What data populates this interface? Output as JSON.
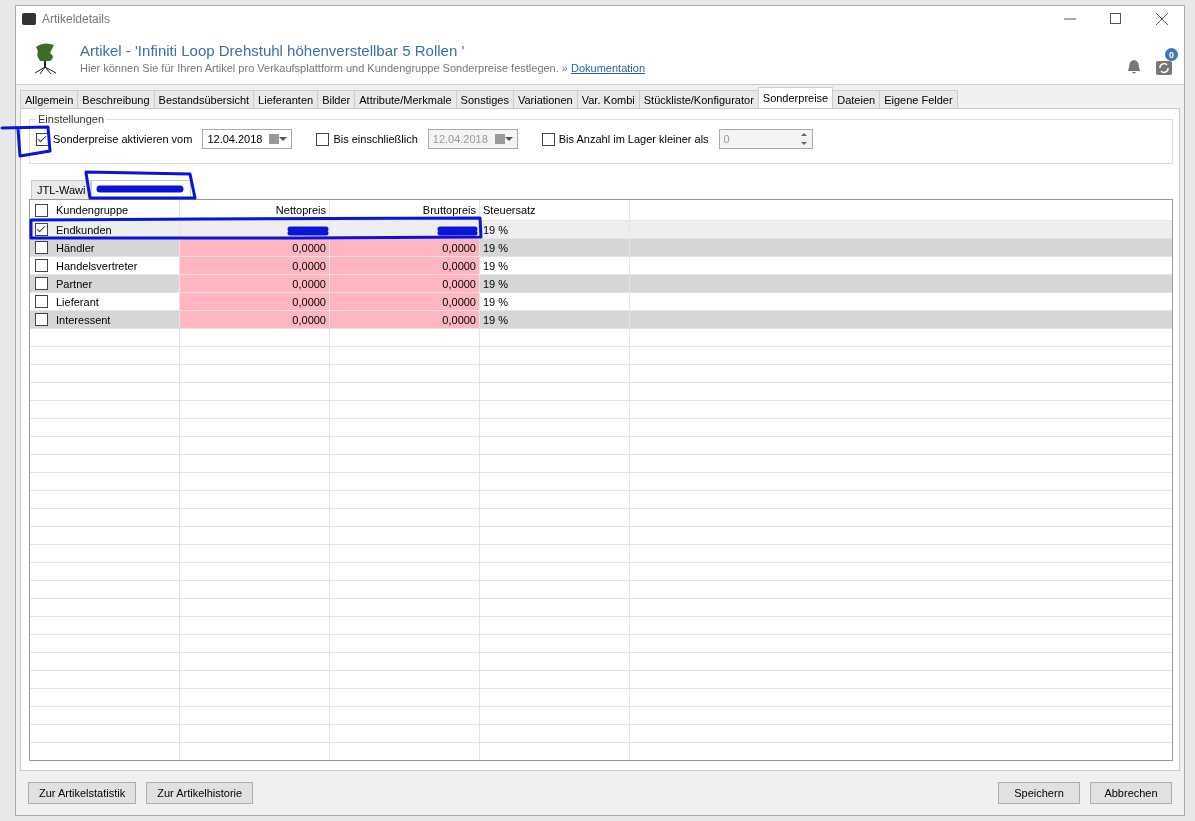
{
  "window": {
    "title": "Artikeldetails"
  },
  "header": {
    "title": "Artikel - 'Infiniti Loop Drehstuhl höhenverstellbar 5 Rollen '",
    "subtitle": "Hier können Sie für Ihren Artikel pro Verkaufsplattform und Kundengruppe Sonderpreise festlegen. »",
    "link": "Dokumentation",
    "badge": "0"
  },
  "tabs": [
    {
      "label": "Allgemein",
      "selected": false
    },
    {
      "label": "Beschreibung",
      "selected": false
    },
    {
      "label": "Bestandsübersicht",
      "selected": false
    },
    {
      "label": "Lieferanten",
      "selected": false
    },
    {
      "label": "Bilder",
      "selected": false
    },
    {
      "label": "Attribute/Merkmale",
      "selected": false
    },
    {
      "label": "Sonstiges",
      "selected": false
    },
    {
      "label": "Variationen",
      "selected": false
    },
    {
      "label": "Var. Kombi",
      "selected": false
    },
    {
      "label": "Stückliste/Konfigurator",
      "selected": false
    },
    {
      "label": "Sonderpreise",
      "selected": true
    },
    {
      "label": "Dateien",
      "selected": false
    },
    {
      "label": "Eigene Felder",
      "selected": false
    }
  ],
  "settings": {
    "title": "Einstellungen",
    "active_from": {
      "label": "Sonderpreise aktivieren vom",
      "checked": true,
      "date": "12.04.2018"
    },
    "until": {
      "label": "Bis einschließlich",
      "checked": false,
      "date": "12.04.2018"
    },
    "stock": {
      "label": "Bis Anzahl im Lager kleiner als",
      "checked": false,
      "value": "0"
    }
  },
  "platform_tabs": [
    {
      "label": "JTL-Wawi",
      "selected": false
    },
    {
      "selected": true
    }
  ],
  "table": {
    "all_selected": false,
    "columns": [
      "Kundengruppe",
      "Nettopreis",
      "Bruttopreis",
      "Steuersatz"
    ],
    "rows": [
      {
        "name": "Endkunden",
        "checked": true,
        "tax": "19 %"
      },
      {
        "name": "Händler",
        "checked": false,
        "net": "0,0000",
        "gross": "0,0000",
        "tax": "19 %"
      },
      {
        "name": "Handelsvertreter",
        "checked": false,
        "net": "0,0000",
        "gross": "0,0000",
        "tax": "19 %"
      },
      {
        "name": "Partner",
        "checked": false,
        "net": "0,0000",
        "gross": "0,0000",
        "tax": "19 %"
      },
      {
        "name": "Lieferant",
        "checked": false,
        "net": "0,0000",
        "gross": "0,0000",
        "tax": "19 %"
      },
      {
        "name": "Interessent",
        "checked": false,
        "net": "0,0000",
        "gross": "0,0000",
        "tax": "19 %"
      }
    ]
  },
  "footer": {
    "left_buttons": [
      "Zur Artikelstatistik",
      "Zur Artikelhistorie"
    ],
    "right_buttons": [
      "Speichern",
      "Abbrechen"
    ]
  }
}
